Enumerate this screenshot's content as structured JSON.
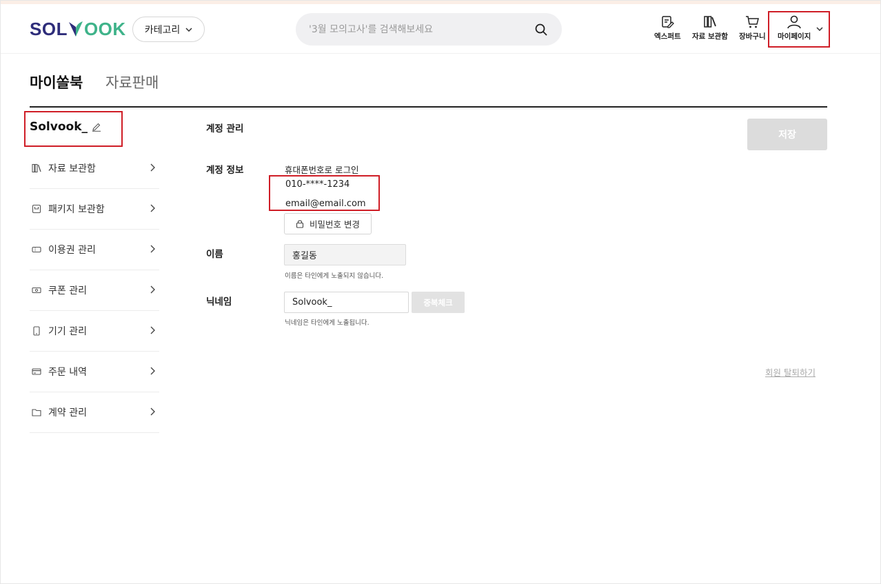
{
  "header": {
    "logo": {
      "part1": "SOL",
      "part2": "OOK"
    },
    "category_button": "카테고리",
    "search": {
      "placeholder": "'3월 모의고사'를 검색해보세요",
      "value": ""
    },
    "nav": [
      {
        "label": "엑스퍼트",
        "icon": "expert-icon"
      },
      {
        "label": "자료 보관함",
        "icon": "library-icon"
      },
      {
        "label": "장바구니",
        "icon": "cart-icon"
      },
      {
        "label": "마이페이지",
        "icon": "user-icon"
      }
    ]
  },
  "tabs": {
    "active": "마이쏠북",
    "inactive": "자료판매"
  },
  "sidebar": {
    "profile_name": "Solvook_",
    "items": [
      {
        "label": "자료 보관함",
        "icon": "books-icon"
      },
      {
        "label": "패키지 보관함",
        "icon": "package-icon"
      },
      {
        "label": "이용권 관리",
        "icon": "ticket-icon"
      },
      {
        "label": "쿠폰 관리",
        "icon": "coupon-icon"
      },
      {
        "label": "기기 관리",
        "icon": "device-icon"
      },
      {
        "label": "주문 내역",
        "icon": "card-icon"
      },
      {
        "label": "계약 관리",
        "icon": "folder-icon"
      }
    ]
  },
  "account": {
    "section_title": "계정 관리",
    "save_label": "저장",
    "info_label": "계정 정보",
    "login_method": "휴대폰번호로 로그인",
    "phone": "010-****-1234",
    "email": "email@email.com",
    "password_button": "비밀번호 변경",
    "name_label": "이름",
    "name_value": "홍길동",
    "name_hint": "이름은 타인에게 노출되지 않습니다.",
    "nickname_label": "닉네임",
    "nickname_value": "Solvook_",
    "dup_check_label": "중복체크",
    "nickname_hint": "닉네임은 타인에게 노출됩니다.",
    "withdraw_label": "회원 탈퇴하기"
  },
  "colors": {
    "brand_navy": "#2e2d7a",
    "brand_green": "#3fb38a",
    "highlight_red": "#cf1d26"
  }
}
